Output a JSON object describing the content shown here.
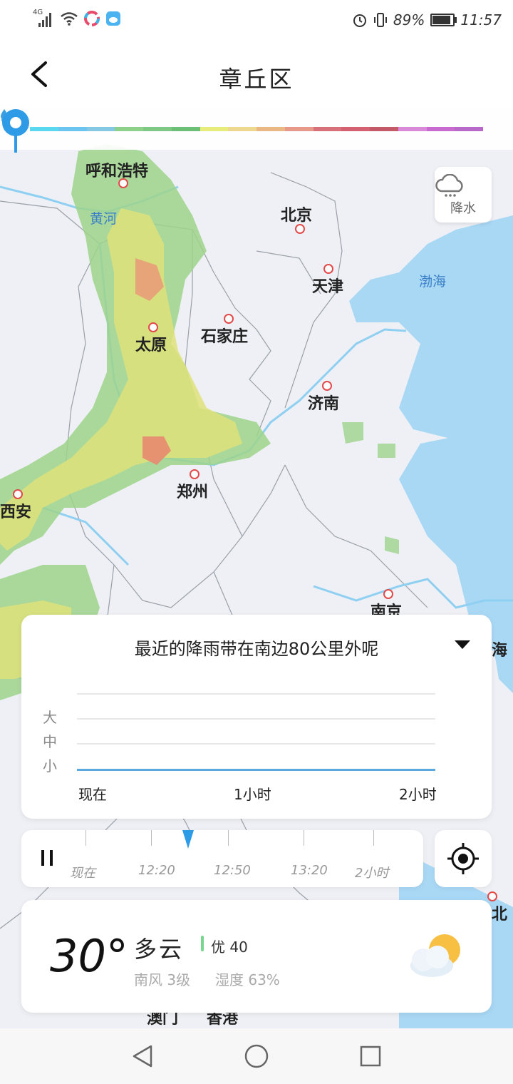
{
  "status_bar": {
    "network": "4G",
    "battery": "89%",
    "battery_level": 0.89,
    "time": "11:57"
  },
  "header": {
    "title": "章丘区"
  },
  "map": {
    "precip_legend_colors": [
      "#5ad8f0",
      "#6cc4f0",
      "#84c8e4",
      "#8cd08c",
      "#7cc884",
      "#6cbf76",
      "#e8ec7a",
      "#eed890",
      "#eab884",
      "#e89a8a",
      "#d8707a",
      "#d46070",
      "#c45a68",
      "#d88ad8",
      "#c86ad0",
      "#b868c8"
    ],
    "precip_button_label": "降水",
    "cities": {
      "huhehaote": "呼和浩特",
      "beijing": "北京",
      "tianjin": "天津",
      "taiyuan": "太原",
      "shijiazhuang": "石家庄",
      "jinan": "济南",
      "zhengzhou": "郑州",
      "xian": "西安",
      "nanjing": "南京",
      "shanghai_partial": "海",
      "taipei_partial": "北",
      "macau": "澳门",
      "hongkong": "香港"
    },
    "waters": {
      "huanghe": "黄河",
      "bohai": "渤海"
    }
  },
  "forecast": {
    "summary": "最近的降雨带在南边80公里外呢",
    "y_labels": [
      "大",
      "中",
      "小"
    ],
    "x_labels": [
      "现在",
      "1小时",
      "2小时"
    ]
  },
  "timeline": {
    "labels": [
      "现在",
      "12:20",
      "12:50",
      "13:20",
      "2小时"
    ]
  },
  "weather": {
    "temperature": "30°",
    "condition": "多云",
    "aqi": "优 40",
    "wind": "南风 3级",
    "humidity": "湿度 63%"
  }
}
